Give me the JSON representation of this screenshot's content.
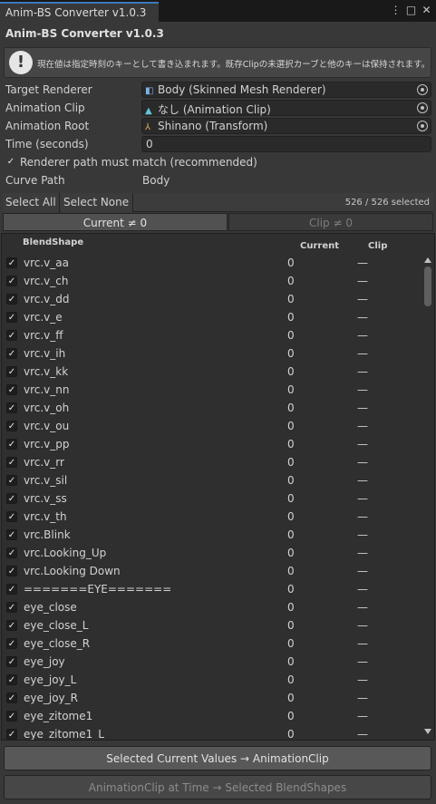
{
  "window": {
    "tab_title": "Anim-BS Converter v1.0.3",
    "menu_icon": "kebab-menu-icon",
    "maximize_icon": "maximize-icon",
    "close_icon": "close-icon"
  },
  "header": {
    "title": "Anim-BS Converter v1.0.3"
  },
  "help": {
    "icon": "info-icon",
    "text": "現在値は指定時刻のキーとして書き込まれます。既存Clipの未選択カーブと他のキーは保持されます。"
  },
  "fields": {
    "target_renderer": {
      "label": "Target Renderer",
      "value": "Body (Skinned Mesh Renderer)",
      "icon": "skinned-mesh-icon"
    },
    "animation_clip": {
      "label": "Animation Clip",
      "value": "なし (Animation Clip)",
      "icon": "animation-clip-icon"
    },
    "animation_root": {
      "label": "Animation Root",
      "value": "Shinano (Transform)",
      "icon": "transform-icon"
    },
    "time": {
      "label": "Time (seconds)",
      "value": "0"
    },
    "path_match": {
      "label": "Renderer path must match (recommended)",
      "checked": true
    },
    "curve_path": {
      "label": "Curve Path",
      "value": "Body"
    }
  },
  "toolbar": {
    "select_all": "Select All",
    "select_none": "Select None",
    "count": "526 / 526 selected"
  },
  "filter_tabs": {
    "current": "Current ≠ 0",
    "clip": "Clip ≠ 0"
  },
  "list": {
    "header_name": "BlendShape",
    "header_current": "Current",
    "header_clip": "Clip",
    "rows": [
      {
        "name": "vrc.v_aa",
        "current": "0",
        "clip": "—"
      },
      {
        "name": "vrc.v_ch",
        "current": "0",
        "clip": "—"
      },
      {
        "name": "vrc.v_dd",
        "current": "0",
        "clip": "—"
      },
      {
        "name": "vrc.v_e",
        "current": "0",
        "clip": "—"
      },
      {
        "name": "vrc.v_ff",
        "current": "0",
        "clip": "—"
      },
      {
        "name": "vrc.v_ih",
        "current": "0",
        "clip": "—"
      },
      {
        "name": "vrc.v_kk",
        "current": "0",
        "clip": "—"
      },
      {
        "name": "vrc.v_nn",
        "current": "0",
        "clip": "—"
      },
      {
        "name": "vrc.v_oh",
        "current": "0",
        "clip": "—"
      },
      {
        "name": "vrc.v_ou",
        "current": "0",
        "clip": "—"
      },
      {
        "name": "vrc.v_pp",
        "current": "0",
        "clip": "—"
      },
      {
        "name": "vrc.v_rr",
        "current": "0",
        "clip": "—"
      },
      {
        "name": "vrc.v_sil",
        "current": "0",
        "clip": "—"
      },
      {
        "name": "vrc.v_ss",
        "current": "0",
        "clip": "—"
      },
      {
        "name": "vrc.v_th",
        "current": "0",
        "clip": "—"
      },
      {
        "name": "vrc.Blink",
        "current": "0",
        "clip": "—"
      },
      {
        "name": "vrc.Looking_Up",
        "current": "0",
        "clip": "—"
      },
      {
        "name": "vrc.Looking Down",
        "current": "0",
        "clip": "—"
      },
      {
        "name": "=======EYE=======",
        "current": "0",
        "clip": "—"
      },
      {
        "name": "eye_close",
        "current": "0",
        "clip": "—"
      },
      {
        "name": "eye_close_L",
        "current": "0",
        "clip": "—"
      },
      {
        "name": "eye_close_R",
        "current": "0",
        "clip": "—"
      },
      {
        "name": "eye_joy",
        "current": "0",
        "clip": "—"
      },
      {
        "name": "eye_joy_L",
        "current": "0",
        "clip": "—"
      },
      {
        "name": "eye_joy_R",
        "current": "0",
        "clip": "—"
      },
      {
        "name": "eye_zitome1",
        "current": "0",
        "clip": "—"
      },
      {
        "name": "eye_zitome1_L",
        "current": "0",
        "clip": "—"
      }
    ]
  },
  "actions": {
    "apply_to_clip": "Selected Current Values → AnimationClip",
    "apply_to_blendshapes": "AnimationClip at Time → Selected BlendShapes"
  }
}
